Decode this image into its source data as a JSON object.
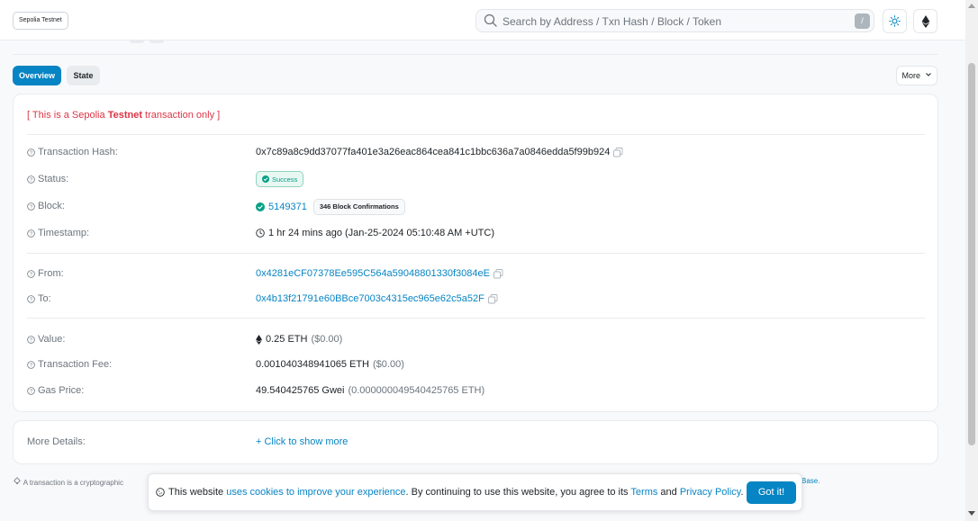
{
  "header": {
    "network_badge": "Sepolia Testnet",
    "search": {
      "placeholder": "Search by Address / Txn Hash / Block / Token",
      "shortcut": "/"
    }
  },
  "tabs": [
    {
      "label": "Overview",
      "active": true
    },
    {
      "label": "State",
      "active": false
    }
  ],
  "more_button": "More",
  "notice": {
    "prefix": "[ This is a Sepolia ",
    "bold": "Testnet",
    "suffix": " transaction only ]"
  },
  "details": {
    "tx_hash": {
      "label": "Transaction Hash:",
      "value": "0x7c89a8c9dd37077fa401e3a26eac864cea841c1bbc636a7a0846edda5f99b924"
    },
    "status": {
      "label": "Status:",
      "value": "Success"
    },
    "block": {
      "label": "Block:",
      "value": "5149371",
      "confirmations": "346 Block Confirmations"
    },
    "timestamp": {
      "label": "Timestamp:",
      "value": "1 hr 24 mins ago (Jan-25-2024 05:10:48 AM +UTC)"
    },
    "from": {
      "label": "From:",
      "value": "0x4281eCF07378Ee595C564a59048801330f3084eE"
    },
    "to": {
      "label": "To:",
      "value": "0x4b13f21791e60BBce7003c4315ec965e62c5a52F"
    },
    "value": {
      "label": "Value:",
      "amount": "0.25 ETH",
      "usd": "($0.00)"
    },
    "fee": {
      "label": "Transaction Fee:",
      "amount": "0.001040348941065 ETH",
      "usd": "($0.00)"
    },
    "gas_price": {
      "label": "Gas Price:",
      "amount": "49.540425765 Gwei",
      "eth": "(0.000000049540425765 ETH)"
    }
  },
  "more_details": {
    "label": "More Details:",
    "link": "+ Click to show more"
  },
  "footnote": {
    "start": "A transaction is a cryptographic",
    "end": "Base."
  },
  "cookie": {
    "prefix": "This website ",
    "link1": "uses cookies to improve your experience",
    "middle": ". By continuing to use this website, you agree to its ",
    "terms": "Terms",
    "and": " and ",
    "privacy": "Privacy Policy",
    "end": ".",
    "button": "Got it!"
  },
  "colors": {
    "accent": "#0784c3",
    "success": "#00a186",
    "danger": "#dc3545"
  }
}
